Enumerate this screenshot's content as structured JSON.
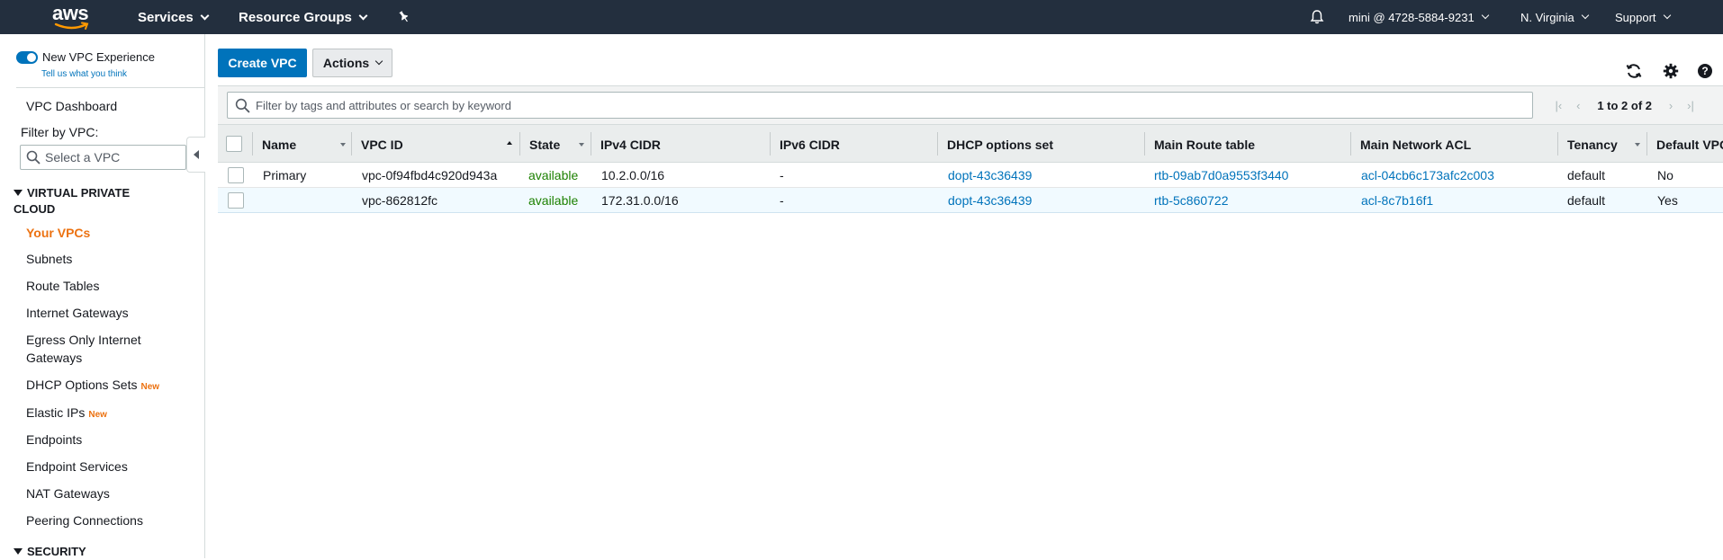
{
  "header": {
    "logo_text": "aws",
    "services": "Services",
    "resource_groups": "Resource Groups",
    "account": "mini @ 4728-5884-9231",
    "region": "N. Virginia",
    "support": "Support"
  },
  "sidebar": {
    "toggle_label": "New VPC Experience",
    "tell_us": "Tell us what you think",
    "dashboard": "VPC Dashboard",
    "filter_label": "Filter by VPC:",
    "filter_placeholder": "Select a VPC",
    "section_vpc": "VIRTUAL PRIVATE CLOUD",
    "section_security": "SECURITY",
    "new_badge": "New",
    "items": [
      {
        "label": "Your VPCs"
      },
      {
        "label": "Subnets"
      },
      {
        "label": "Route Tables"
      },
      {
        "label": "Internet Gateways"
      },
      {
        "label": "Egress Only Internet Gateways"
      },
      {
        "label": "DHCP Options Sets"
      },
      {
        "label": "Elastic IPs"
      },
      {
        "label": "Endpoints"
      },
      {
        "label": "Endpoint Services"
      },
      {
        "label": "NAT Gateways"
      },
      {
        "label": "Peering Connections"
      }
    ]
  },
  "toolbar": {
    "create_label": "Create VPC",
    "actions_label": "Actions"
  },
  "filter": {
    "placeholder": "Filter by tags and attributes or search by keyword",
    "pagination": "1 to 2 of 2"
  },
  "table": {
    "columns": [
      "Name",
      "VPC ID",
      "State",
      "IPv4 CIDR",
      "IPv6 CIDR",
      "DHCP options set",
      "Main Route table",
      "Main Network ACL",
      "Tenancy",
      "Default VPC"
    ],
    "rows": [
      {
        "name": "Primary",
        "vpc_id": "vpc-0f94fbd4c920d943a",
        "state": "available",
        "ipv4": "10.2.0.0/16",
        "ipv6": "-",
        "dhcp": "dopt-43c36439",
        "route": "rtb-09ab7d0a9553f3440",
        "acl": "acl-04cb6c173afc2c003",
        "tenancy": "default",
        "default": "No"
      },
      {
        "name": "",
        "vpc_id": "vpc-862812fc",
        "state": "available",
        "ipv4": "172.31.0.0/16",
        "ipv6": "-",
        "dhcp": "dopt-43c36439",
        "route": "rtb-5c860722",
        "acl": "acl-8c7b16f1",
        "tenancy": "default",
        "default": "Yes"
      }
    ]
  },
  "colors": {
    "nav_bg": "#232f3e",
    "primary": "#0073bb",
    "active_nav": "#ec7211",
    "status_ok": "#1d8102"
  }
}
